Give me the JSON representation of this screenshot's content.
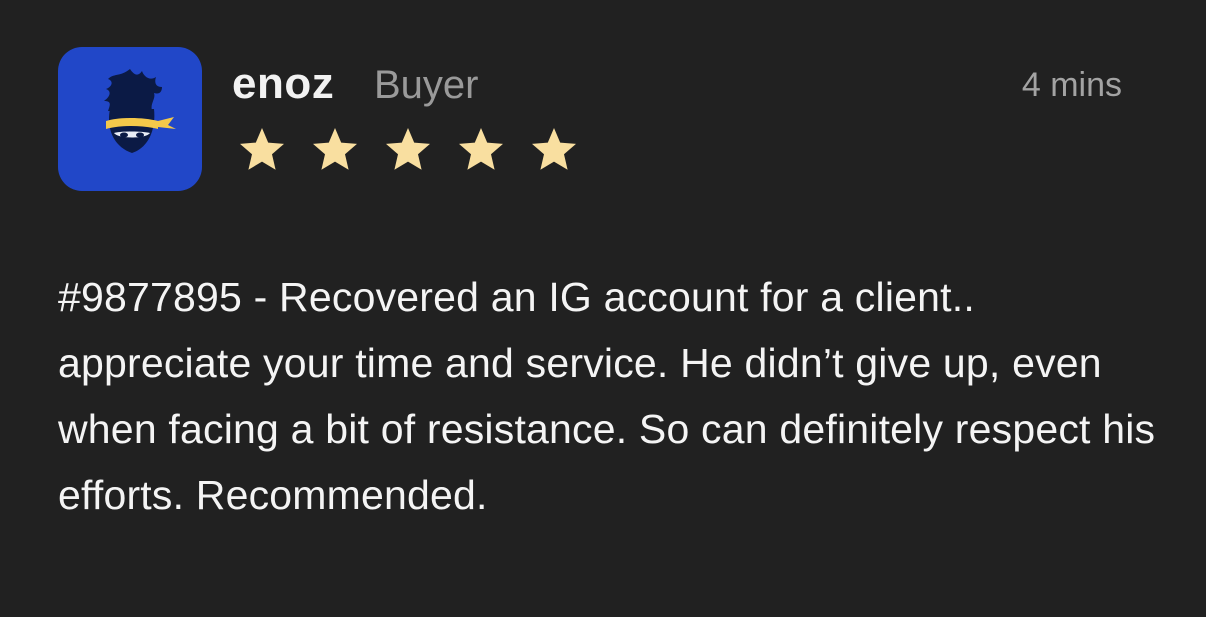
{
  "review": {
    "username": "enoz",
    "role": "Buyer",
    "timestamp": "4 mins",
    "rating": 5,
    "rating_max": 5,
    "text": "#9877895 - Recovered an IG account for a client.. appreciate your time and service. He didn’t give up, even when facing a bit of resistance. So can definitely respect his efforts. Recommended.",
    "avatar_icon": "ninja-avatar-icon",
    "star_icon": "star-icon"
  },
  "colors": {
    "background": "#212121",
    "avatar_bg": "#2147c8",
    "star": "#f9dfa0",
    "text": "#f4f4f4",
    "muted": "#9a9a9a"
  }
}
